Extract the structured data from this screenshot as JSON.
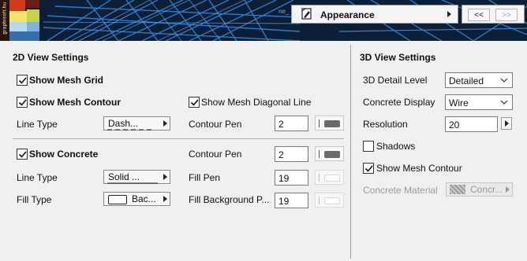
{
  "header": {
    "banner_vertical_text": "graphisoft.hu",
    "banner_side_text": "ne_",
    "panel_label": "Appearance",
    "nav_prev": "<<",
    "nav_next": ">>"
  },
  "view2d": {
    "title": "2D View Settings",
    "show_mesh_grid": {
      "label": "Show Mesh Grid",
      "checked": true
    },
    "show_mesh_contour": {
      "label": "Show Mesh Contour",
      "checked": true
    },
    "show_mesh_diagonal": {
      "label": "Show Mesh Diagonal Line",
      "checked": true
    },
    "line_type_label": "Line Type",
    "line_type_value": "Dash...",
    "contour_pen_label": "Contour Pen",
    "contour_pen_value": "2",
    "show_concrete": {
      "label": "Show Concrete",
      "checked": true
    },
    "concrete_contour_pen_label": "Contour Pen",
    "concrete_contour_pen_value": "2",
    "concrete_line_type_label": "Line Type",
    "concrete_line_type_value": "Solid ...",
    "fill_pen_label": "Fill Pen",
    "fill_pen_value": "19",
    "fill_type_label": "Fill Type",
    "fill_type_value": "Bac...",
    "fill_bg_pen_label": "Fill Background P...",
    "fill_bg_pen_value": "19"
  },
  "view3d": {
    "title": "3D View Settings",
    "detail_label": "3D Detail Level",
    "detail_value": "Detailed",
    "concrete_display_label": "Concrete Display",
    "concrete_display_value": "Wire",
    "resolution_label": "Resolution",
    "resolution_value": "20",
    "shadows": {
      "label": "Shadows",
      "checked": false
    },
    "show_mesh_contour": {
      "label": "Show Mesh Contour",
      "checked": true
    },
    "material_label": "Concrete Material",
    "material_value": "Concr..."
  }
}
